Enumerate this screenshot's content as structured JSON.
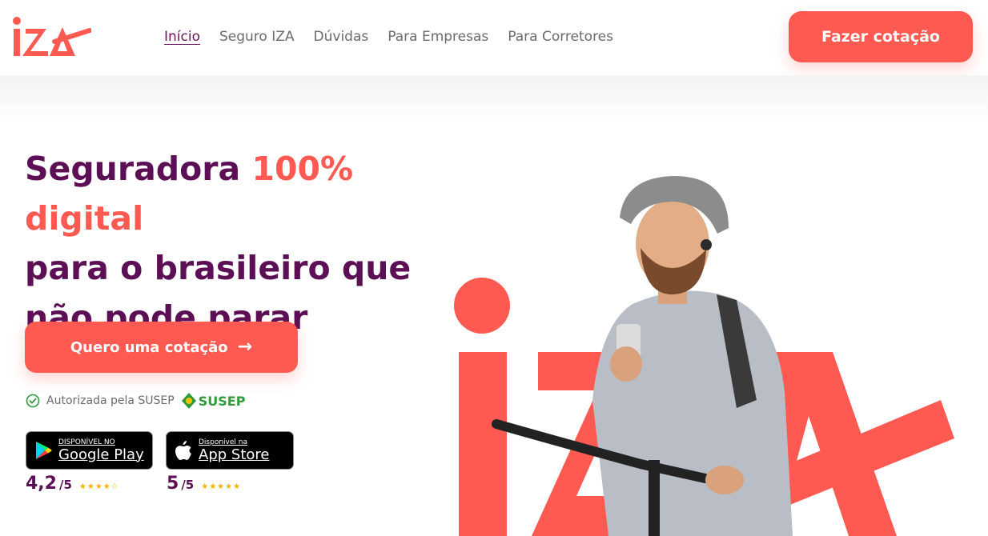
{
  "header": {
    "logo_text": "IZA",
    "nav": [
      {
        "label": "Início",
        "active": true
      },
      {
        "label": "Seguro IZA",
        "active": false
      },
      {
        "label": "Dúvidas",
        "active": false
      },
      {
        "label": "Para Empresas",
        "active": false
      },
      {
        "label": "Para Corretores",
        "active": false
      }
    ],
    "cta_label": "Fazer cotação"
  },
  "hero": {
    "headline_part1": "Seguradora ",
    "headline_accent": "100% digital",
    "headline_part2": "para o brasileiro que não pode parar",
    "cta_label": "Quero uma cotação",
    "cta_icon": "arrow-right-icon",
    "susep_text": "Autorizada pela SUSEP",
    "susep_logo_text": "SUSEP"
  },
  "stores": {
    "google_play": {
      "small": "DISPONÍVEL NO",
      "big": "Google Play",
      "score": "4,2",
      "denominator": "/5",
      "stars": 4.2
    },
    "app_store": {
      "small": "Disponível na",
      "big": "App Store",
      "score": "5",
      "denominator": "/5",
      "stars": 5
    }
  },
  "colors": {
    "brand_coral": "#ff5a52",
    "brand_purple": "#5c0f55",
    "nav_text": "#6b6b6b",
    "star": "#f5b400"
  }
}
